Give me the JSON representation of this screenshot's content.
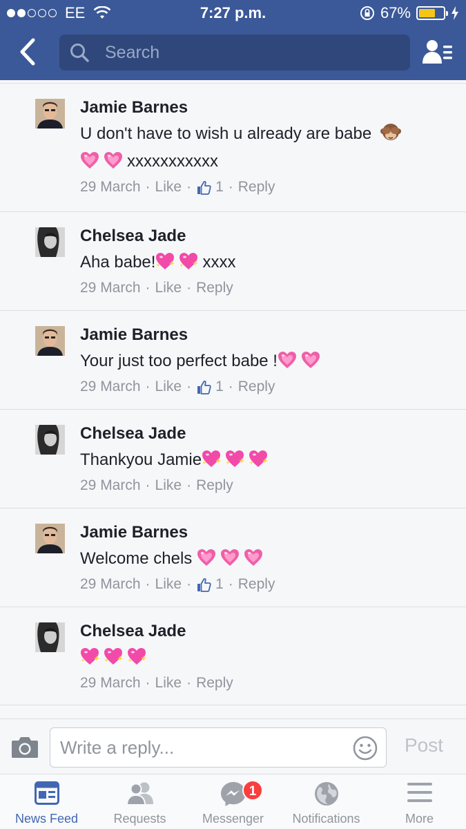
{
  "status_bar": {
    "carrier": "EE",
    "time": "7:27 p.m.",
    "battery_percent": "67%",
    "battery_level": 0.67,
    "signal_bars_filled": 2,
    "signal_bars_total": 5
  },
  "header": {
    "search_placeholder": "Search",
    "back_icon": "chevron-left-icon",
    "friends_icon": "friend-list-icon",
    "background_color": "#3b5998"
  },
  "comments": [
    {
      "author": "Jamie Barnes",
      "text_lines": [
        "U don't have to wish u already are babe",
        "xxxxxxxxxxx"
      ],
      "date": "29 March",
      "like_label": "Like",
      "likes": "1",
      "reply_label": "Reply"
    },
    {
      "author": "Chelsea Jade",
      "text_lines": [
        "Aha babe!",
        "xxxx"
      ],
      "date": "29 March",
      "like_label": "Like",
      "reply_label": "Reply"
    },
    {
      "author": "Jamie Barnes",
      "text_lines": [
        "Your just too perfect babe !"
      ],
      "date": "29 March",
      "like_label": "Like",
      "likes": "1",
      "reply_label": "Reply"
    },
    {
      "author": "Chelsea Jade",
      "text_lines": [
        "Thankyou Jamie"
      ],
      "date": "29 March",
      "like_label": "Like",
      "reply_label": "Reply"
    },
    {
      "author": "Jamie Barnes",
      "text_lines": [
        "Welcome chels"
      ],
      "date": "29 March",
      "like_label": "Like",
      "likes": "1",
      "reply_label": "Reply"
    },
    {
      "author": "Chelsea Jade",
      "text_lines": [
        ""
      ],
      "date": "29 March",
      "like_label": "Like",
      "reply_label": "Reply"
    }
  ],
  "reply_bar": {
    "placeholder": "Write a reply...",
    "post_label": "Post"
  },
  "tab_bar": {
    "tabs": [
      {
        "label": "News Feed",
        "icon": "news-feed-icon",
        "active": true
      },
      {
        "label": "Requests",
        "icon": "friend-requests-icon"
      },
      {
        "label": "Messenger",
        "icon": "messenger-icon",
        "badge": "1"
      },
      {
        "label": "Notifications",
        "icon": "globe-icon"
      },
      {
        "label": "More",
        "icon": "hamburger-menu-icon"
      }
    ]
  },
  "colors": {
    "accent": "#4267b2",
    "badge": "#fa3e3e",
    "battery": "#f5c518"
  }
}
